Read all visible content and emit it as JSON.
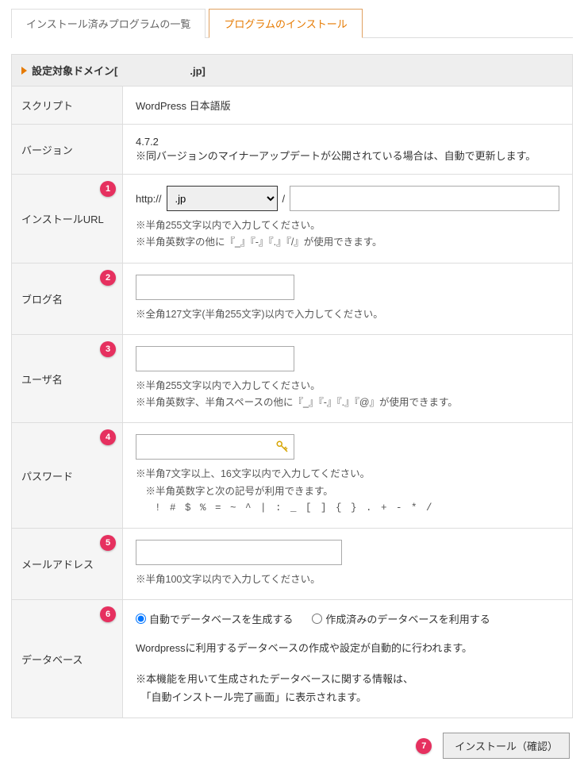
{
  "tabs": {
    "installed": "インストール済みプログラムの一覧",
    "install": "プログラムのインストール"
  },
  "header": {
    "prefix": "設定対象ドメイン[",
    "domain_display": "　　　　　　　.jp",
    "suffix": "]"
  },
  "rows": {
    "script": {
      "label": "スクリプト",
      "value": "WordPress 日本語版"
    },
    "version": {
      "label": "バージョン",
      "value": "4.7.2",
      "note": "※同バージョンのマイナーアップデートが公開されている場合は、自動で更新します。"
    },
    "install_url": {
      "label": "インストールURL",
      "badge": "1",
      "scheme": "http://",
      "select_option": "　　　　　　.jp",
      "slash": "/",
      "hint1": "※半角255文字以内で入力してください。",
      "hint2": "※半角英数字の他に『_』『-』『.』『/』が使用できます。"
    },
    "blog_name": {
      "label": "ブログ名",
      "badge": "2",
      "hint": "※全角127文字(半角255文字)以内で入力してください。"
    },
    "user_name": {
      "label": "ユーザ名",
      "badge": "3",
      "hint1": "※半角255文字以内で入力してください。",
      "hint2": "※半角英数字、半角スペースの他に『_』『-』『.』『@』が使用できます。"
    },
    "password": {
      "label": "パスワード",
      "badge": "4",
      "hint1": "※半角7文字以上、16文字以内で入力してください。",
      "hint2": "　※半角英数字と次の記号が利用できます。",
      "hint3": "!  #  $  %  =  ~  ^  |  :  _  [  ]  {  }  .  +  -  *  /"
    },
    "email": {
      "label": "メールアドレス",
      "badge": "5",
      "hint": "※半角100文字以内で入力してください。"
    },
    "database": {
      "label": "データベース",
      "badge": "6",
      "radio_auto": "自動でデータベースを生成する",
      "radio_existing": "作成済みのデータベースを利用する",
      "desc": "Wordpressに利用するデータベースの作成や設定が自動的に行われます。",
      "note1": "※本機能を用いて生成されたデータベースに関する情報は、",
      "note2": "　「自動インストール完了画面」に表示されます。"
    }
  },
  "footer": {
    "badge": "7",
    "button": "インストール（確認）"
  }
}
